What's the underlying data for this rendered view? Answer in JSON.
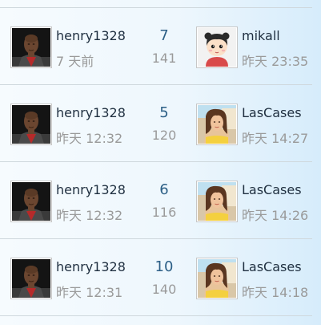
{
  "threads": [
    {
      "author": {
        "name": "henry1328",
        "time": "7 天前",
        "avatar_icon": "man-portrait-avatar"
      },
      "replies": "7",
      "views": "141",
      "last_post": {
        "name": "mikall",
        "time": "昨天 23:35",
        "avatar_icon": "cartoon-girl-avatar"
      }
    },
    {
      "author": {
        "name": "henry1328",
        "time": "昨天 12:32",
        "avatar_icon": "man-portrait-avatar"
      },
      "replies": "5",
      "views": "120",
      "last_post": {
        "name": "LasCases",
        "time": "昨天 14:27",
        "avatar_icon": "woman-photo-avatar"
      }
    },
    {
      "author": {
        "name": "henry1328",
        "time": "昨天 12:32",
        "avatar_icon": "man-portrait-avatar"
      },
      "replies": "6",
      "views": "116",
      "last_post": {
        "name": "LasCases",
        "time": "昨天 14:26",
        "avatar_icon": "woman-photo-avatar"
      }
    },
    {
      "author": {
        "name": "henry1328",
        "time": "昨天 12:31",
        "avatar_icon": "man-portrait-avatar"
      },
      "replies": "10",
      "views": "140",
      "last_post": {
        "name": "LasCases",
        "time": "昨天 14:18",
        "avatar_icon": "woman-photo-avatar"
      }
    }
  ],
  "colors": {
    "name_text": "#1f2f40",
    "muted_text": "#9a9a9a",
    "reply_count": "#2c5f86",
    "divider": "#cfd8dd"
  }
}
